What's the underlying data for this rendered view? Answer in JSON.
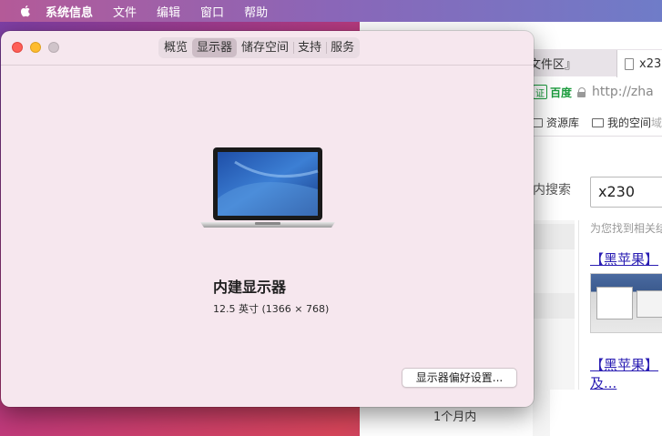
{
  "menubar": {
    "app_name": "系统信息",
    "items": [
      "文件",
      "编辑",
      "窗口",
      "帮助"
    ]
  },
  "browser": {
    "tab_left_label": "文件区』",
    "tab_right_label": "x23",
    "cert_badge": "证",
    "cert_name": "百度",
    "url": "http://zha",
    "bookmarks": [
      "资源库",
      "我的空间"
    ],
    "bookmark_cut": "域",
    "search_label": "内搜索",
    "search_value": "x230",
    "found_text": "为您找到相关结",
    "results": [
      "【黑苹果】",
      "【黑苹果】"
    ],
    "result_suffix": "及...",
    "time_filter": "1个月内"
  },
  "window": {
    "tabs": [
      "概览",
      "显示器",
      "储存空间",
      "支持",
      "服务"
    ],
    "active_tab": 1,
    "display_name": "内建显示器",
    "display_spec": "12.5 英寸 (1366 × 768)",
    "pref_button": "显示器偏好设置..."
  },
  "colors": {
    "close": "#fe5f57",
    "minimize": "#febc2e",
    "window_bg": "#f6e7ee",
    "link": "#2a1db3",
    "cert_green": "#1a9b3c"
  }
}
